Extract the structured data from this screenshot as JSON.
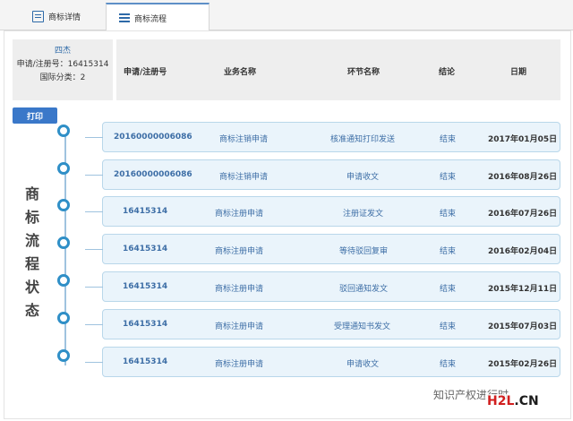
{
  "tabs": [
    {
      "label": "商标详情"
    },
    {
      "label": "商标流程"
    }
  ],
  "owner": {
    "name": "四杰",
    "reg_no": "申请/注册号：16415314",
    "intl_class": "国际分类：2"
  },
  "table": {
    "headers": [
      "申请/注册号",
      "业务名称",
      "环节名称",
      "结论",
      "日期"
    ]
  },
  "print_label": "打印",
  "side_title": [
    "商",
    "标",
    "流",
    "程",
    "状",
    "态"
  ],
  "timeline": [
    {
      "number": "20160000006086",
      "business": "商标注销申请",
      "step": "核准通知打印发送",
      "result": "结束",
      "date": "2017年01月05日"
    },
    {
      "number": "20160000006086",
      "business": "商标注销申请",
      "step": "申请收文",
      "result": "结束",
      "date": "2016年08月26日"
    },
    {
      "number": "16415314",
      "business": "商标注册申请",
      "step": "注册证发文",
      "result": "结束",
      "date": "2016年07月26日"
    },
    {
      "number": "16415314",
      "business": "商标注册申请",
      "step": "等待驳回复审",
      "result": "结束",
      "date": "2016年02月04日"
    },
    {
      "number": "16415314",
      "business": "商标注册申请",
      "step": "驳回通知发文",
      "result": "结束",
      "date": "2015年12月11日"
    },
    {
      "number": "16415314",
      "business": "商标注册申请",
      "step": "受理通知书发文",
      "result": "结束",
      "date": "2015年07月03日"
    },
    {
      "number": "16415314",
      "business": "商标注册申请",
      "step": "申请收文",
      "result": "结束",
      "date": "2015年02月26日"
    }
  ],
  "watermark": "知识产权进行时",
  "brand": {
    "part1": "H2L",
    "part2": ".CN"
  }
}
